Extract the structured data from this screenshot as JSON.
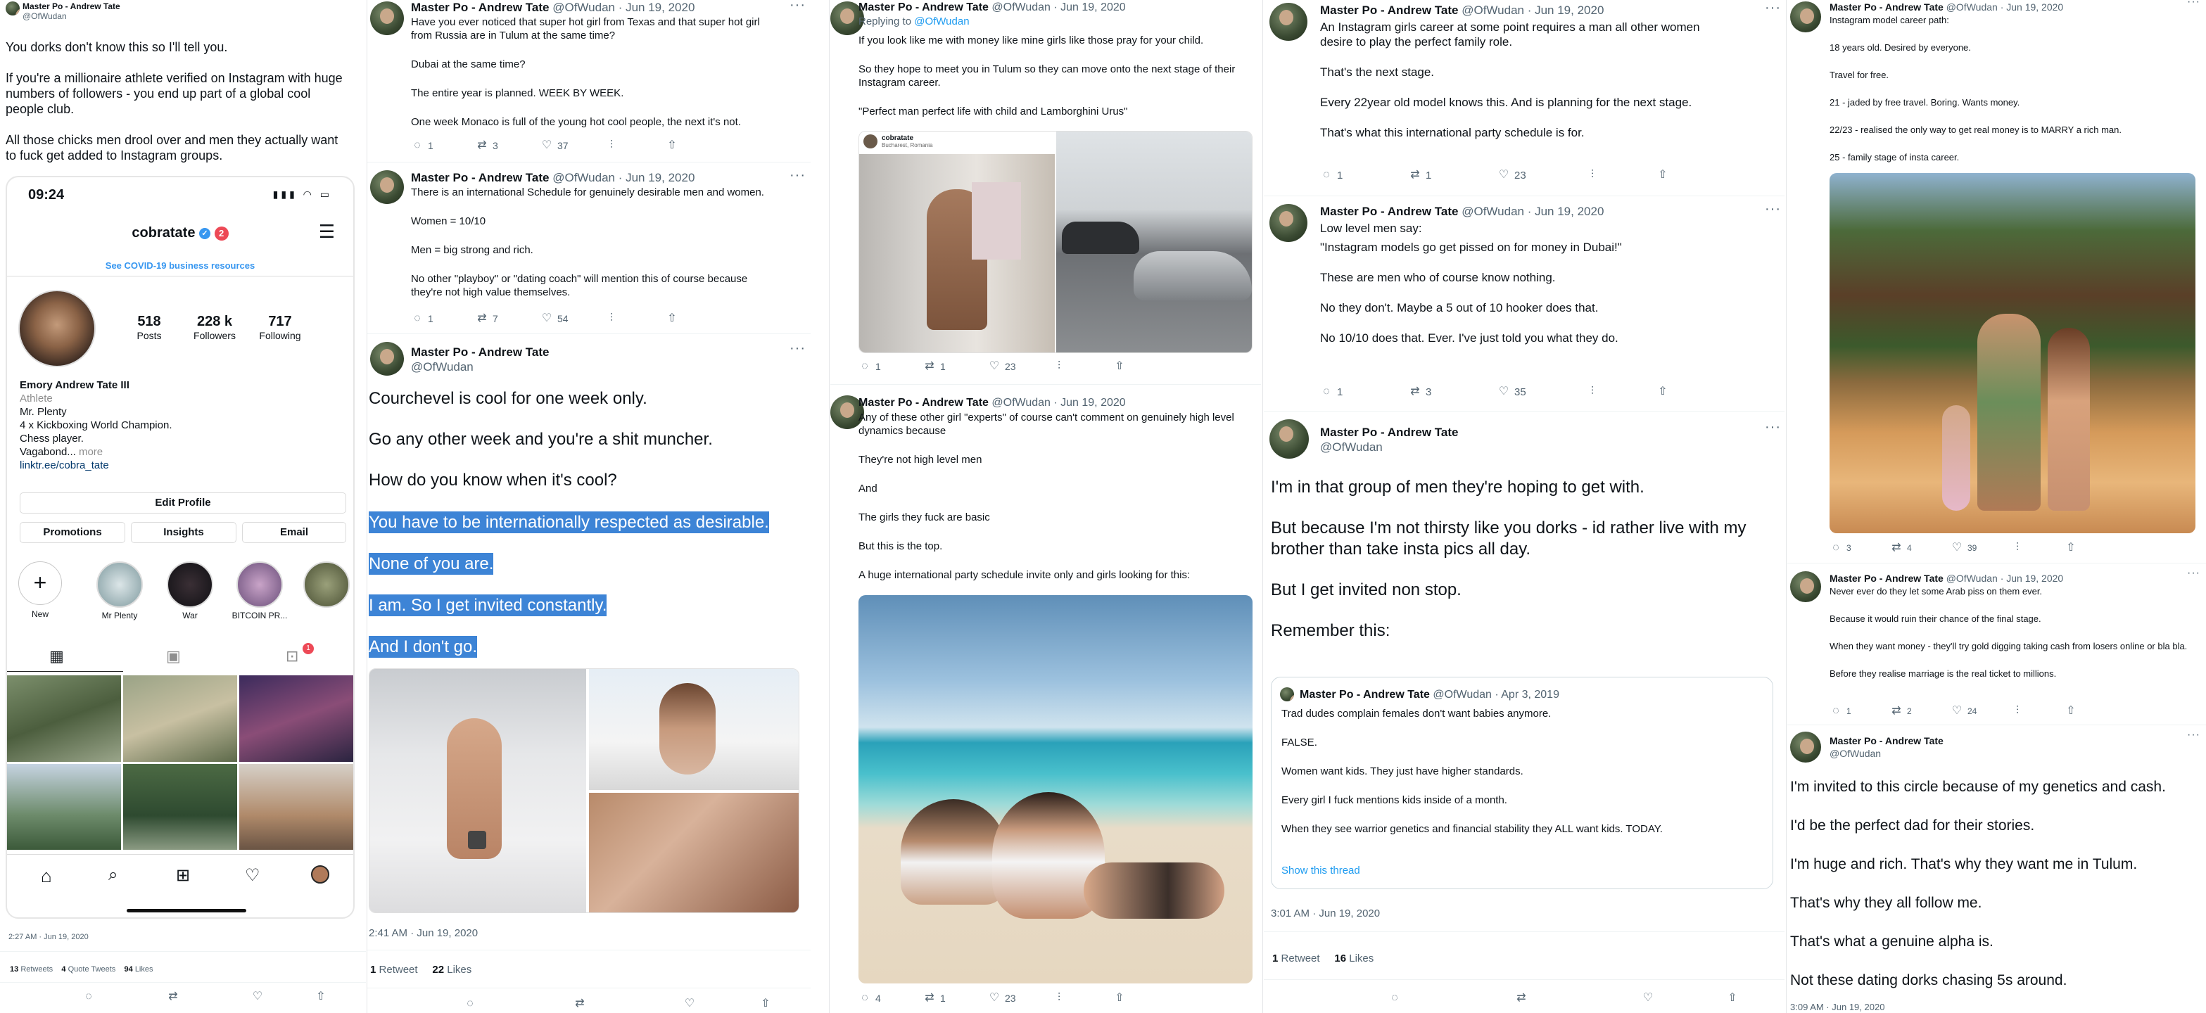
{
  "col1": {
    "user": {
      "name": "Master Po - Andrew Tate",
      "handle": "@OfWudan"
    },
    "text": [
      "You dorks don't know this so I'll tell you.",
      "If you're a millionaire athlete verified on Instagram with huge numbers of followers - you end up part of a global cool people club.",
      "All those chicks men drool over and men they actually want to fuck get added to Instagram groups."
    ],
    "phone": {
      "time": "09:24",
      "username": "cobratate",
      "badge": "2",
      "covid": "See COVID-19 business resources",
      "posts": "518",
      "posts_label": "Posts",
      "followers": "228 k",
      "followers_label": "Followers",
      "following": "717",
      "following_label": "Following",
      "bio_name": "Emory Andrew Tate III",
      "bio_cat": "Athlete",
      "bio1": "Mr. Plenty",
      "bio2": "4 x Kickboxing World Champion.",
      "bio3": "Chess player.",
      "bio4": "Vagabond...",
      "bio_more": "more",
      "bio_link": "linktr.ee/cobra_tate",
      "edit": "Edit Profile",
      "promotions": "Promotions",
      "insights": "Insights",
      "email": "Email",
      "highlights": [
        "New",
        "Mr Plenty",
        "War",
        "BITCOIN PR...",
        ""
      ],
      "notif": "1"
    },
    "timestamp": "2:27 AM · Jun 19, 2020",
    "retweets": "13",
    "retweets_label": "Retweets",
    "quotes": "4",
    "quotes_label": "Quote Tweets",
    "likes": "94",
    "likes_label": "Likes"
  },
  "col2": {
    "t1": {
      "name": "Master Po - Andrew Tate",
      "handle": "@OfWudan · Jun 19, 2020",
      "lines": [
        "Have you ever noticed that super hot girl from Texas and that super hot girl from Russia are in Tulum at the same time?",
        "Dubai at the same time?",
        "The entire year is planned. WEEK BY WEEK.",
        "One week Monaco is full of the young hot cool people, the next it's not."
      ],
      "replies": "1",
      "rts": "3",
      "likes": "37"
    },
    "t2": {
      "name": "Master Po - Andrew Tate",
      "handle": "@OfWudan · Jun 19, 2020",
      "lines": [
        "There is an international Schedule for genuinely desirable men and women.",
        "Women = 10/10",
        "Men = big strong and rich.",
        "No other \"playboy\" or \"dating coach\" will mention this of course because they're not high value themselves."
      ],
      "replies": "1",
      "rts": "7",
      "likes": "54"
    },
    "t3": {
      "name": "Master Po - Andrew Tate",
      "handle": "@OfWudan",
      "lines": [
        "Courchevel is cool for one week only.",
        "Go any other week and you're a shit muncher.",
        "How do you know when it's cool?"
      ],
      "hl": [
        "You have to be internationally respected as desirable.",
        "None of you are.",
        "I am. So I get invited constantly.",
        "And I don't go."
      ],
      "timestamp": "2:41 AM · Jun 19, 2020",
      "retweets": "1",
      "retweets_label": "Retweet",
      "likes": "22",
      "likes_label": "Likes"
    }
  },
  "col3": {
    "t1": {
      "name": "Master Po - Andrew Tate",
      "handle": "@OfWudan · Jun 19, 2020",
      "replying": "Replying to",
      "replying_to": "@OfWudan",
      "lines": [
        "If you look like me with money like mine girls like those pray for your child.",
        "So they hope to meet you in Tulum so they can move onto the next stage of their Instagram career.",
        "\"Perfect man perfect life with child and Lamborghini Urus\""
      ],
      "embed_user": "cobratate",
      "embed_loc": "Bucharest, Romania",
      "replies": "1",
      "rts": "1",
      "likes": "23"
    },
    "t2": {
      "name": "Master Po - Andrew Tate",
      "handle": "@OfWudan · Jun 19, 2020",
      "lines": [
        "Any of these other girl \"experts\" of course can't comment on genuinely high level dynamics because",
        "They're not high level men",
        "And",
        "The girls they fuck are basic",
        "But this is the top.",
        "A huge international party schedule invite only and girls looking for this:"
      ],
      "replies": "4",
      "rts": "1",
      "likes": "23"
    }
  },
  "col4": {
    "t1": {
      "name": "Master Po - Andrew Tate",
      "handle": "@OfWudan · Jun 19, 2020",
      "lines": [
        "An Instagram girls career at some point requires a man all other women desire to play the perfect family role.",
        "That's the next stage.",
        "Every 22year old model knows this. And is planning for the next stage.",
        "That's what this international party schedule is for."
      ],
      "replies": "1",
      "rts": "1",
      "likes": "23"
    },
    "t2": {
      "name": "Master Po - Andrew Tate",
      "handle": "@OfWudan · Jun 19, 2020",
      "lines": [
        "Low level men say:",
        "\"Instagram models go get pissed on for money in Dubai!\"",
        "These are men who of course know nothing.",
        "No they don't. Maybe a 5 out of 10 hooker does that.",
        "No 10/10 does that. Ever. I've just told you what they do."
      ],
      "replies": "1",
      "rts": "3",
      "likes": "35"
    },
    "t3": {
      "name": "Master Po - Andrew Tate",
      "handle": "@OfWudan",
      "lines": [
        "I'm in that group of men they're hoping to get with.",
        "But because I'm not thirsty like you dorks - id rather live with my brother than take insta pics all day.",
        "But I get invited non stop.",
        "Remember this:"
      ],
      "quote": {
        "name": "Master Po - Andrew Tate",
        "handle": "@OfWudan · Apr 3, 2019",
        "lines": [
          "Trad dudes complain females don't want babies anymore.",
          "FALSE.",
          "Women want kids. They just have higher standards.",
          "Every girl I fuck mentions kids inside of a month.",
          "When they see warrior genetics and financial stability they ALL want kids. TODAY."
        ],
        "show": "Show this thread"
      },
      "timestamp": "3:01 AM · Jun 19, 2020",
      "retweets": "1",
      "retweets_label": "Retweet",
      "likes": "16",
      "likes_label": "Likes"
    }
  },
  "col5": {
    "t1": {
      "name": "Master Po - Andrew Tate",
      "handle": "@OfWudan · Jun 19, 2020",
      "lines": [
        "Instagram model career path:",
        "18 years old. Desired by everyone.",
        "Travel for free.",
        "21 - jaded by free travel. Boring. Wants money.",
        "22/23 - realised the only way to get real money is to MARRY a rich man.",
        "25 - family stage of insta career."
      ],
      "replies": "3",
      "rts": "4",
      "likes": "39"
    },
    "t2": {
      "name": "Master Po - Andrew Tate",
      "handle": "@OfWudan · Jun 19, 2020",
      "lines": [
        "Never ever do they let some Arab piss on them ever.",
        "Because it would ruin their chance of the final stage.",
        "When they want money - they'll try gold digging taking cash from losers online or bla bla.",
        "Before they realise marriage is the real ticket to millions."
      ],
      "replies": "1",
      "rts": "2",
      "likes": "24"
    },
    "t3": {
      "name": "Master Po - Andrew Tate",
      "handle": "@OfWudan",
      "lines": [
        "I'm invited to this circle because of my genetics and cash.",
        "I'd be the perfect dad for their stories.",
        "I'm huge and rich. That's why they want me in Tulum.",
        "That's why they all follow me.",
        "That's what a genuine alpha is.",
        "Not these dating dorks chasing 5s around."
      ],
      "timestamp": "3:09 AM · Jun 19, 2020"
    }
  }
}
